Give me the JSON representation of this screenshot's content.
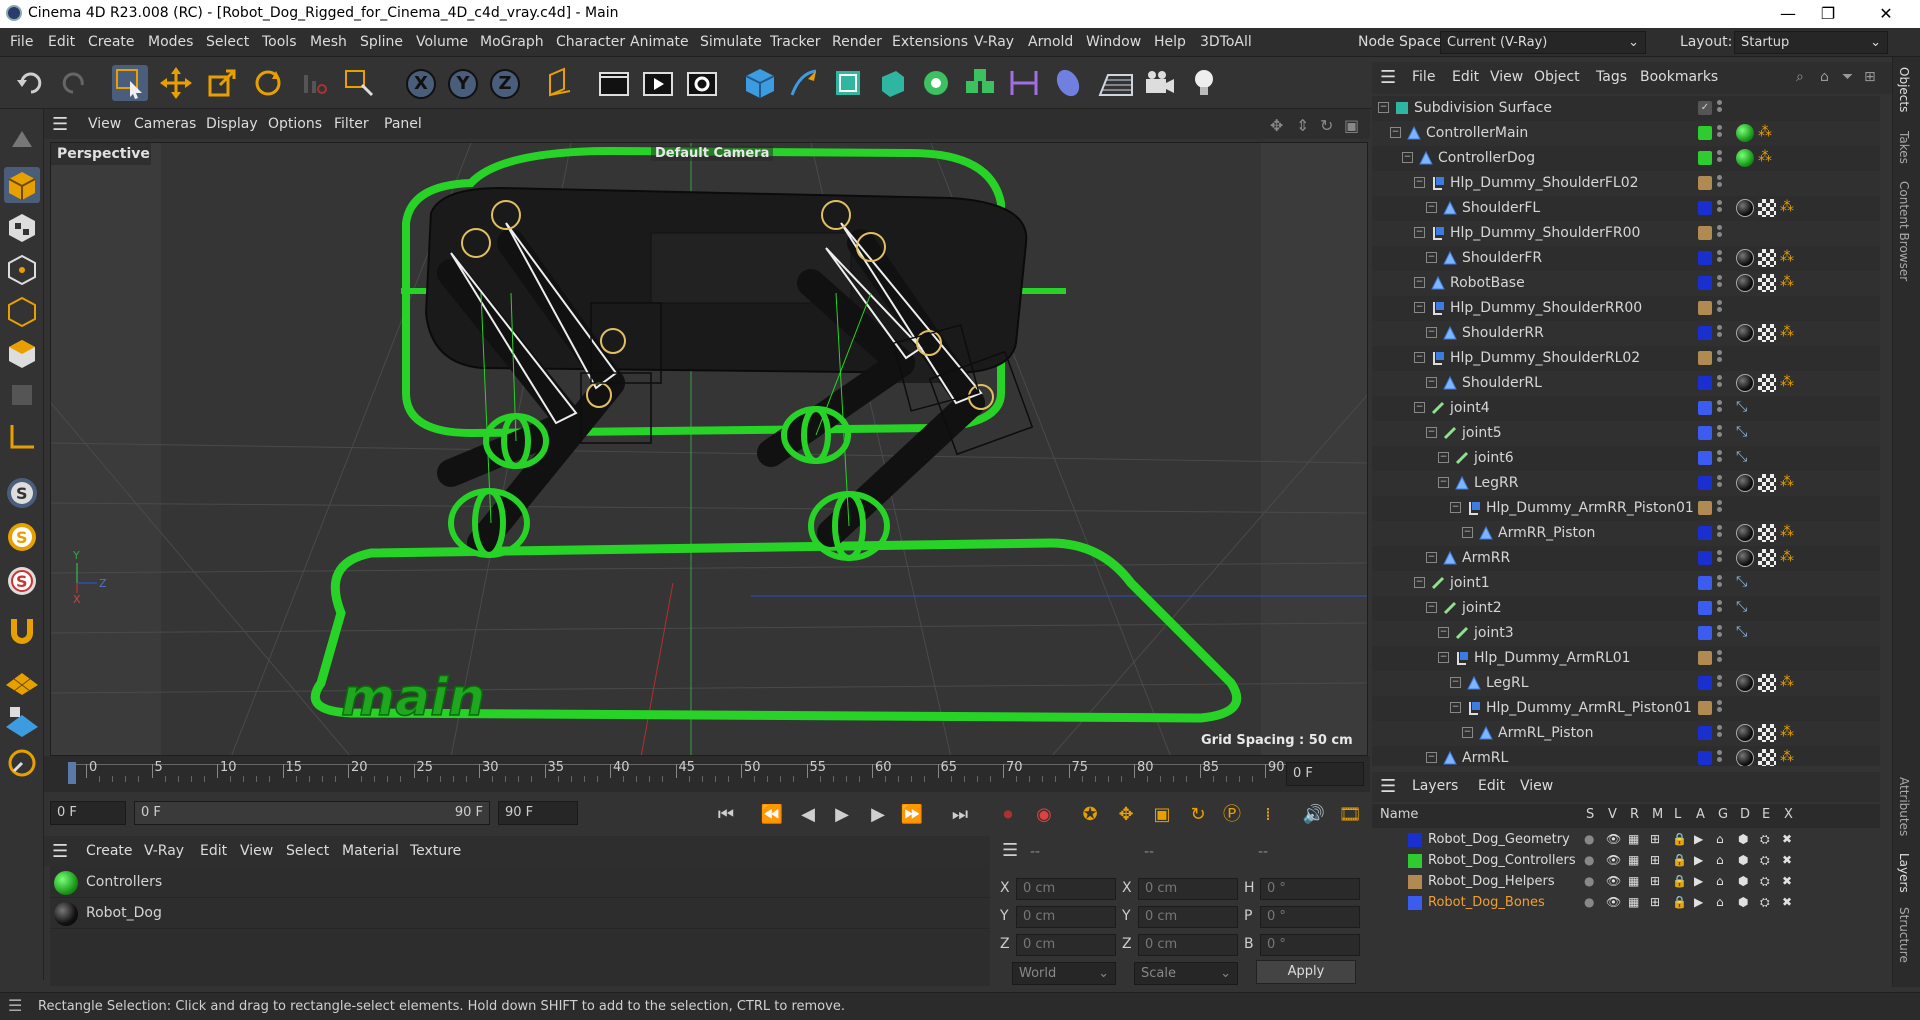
{
  "window": {
    "title": "Cinema 4D R23.008 (RC) - [Robot_Dog_Rigged_for_Cinema_4D_c4d_vray.c4d] - Main",
    "controls": [
      "—",
      "❐",
      "✕"
    ]
  },
  "menubar": {
    "items": [
      "File",
      "Edit",
      "Create",
      "Modes",
      "Select",
      "Tools",
      "Mesh",
      "Spline",
      "Volume",
      "MoGraph",
      "Character",
      "Animate",
      "Simulate",
      "Tracker",
      "Render",
      "Extensions",
      "V-Ray",
      "Arnold",
      "Window",
      "Help",
      "3DToAll"
    ],
    "node_space_label": "Node Space:",
    "node_space_value": "Current (V-Ray)",
    "layout_label": "Layout:",
    "layout_value": "Startup"
  },
  "toolbar": {
    "axis_x": "X",
    "axis_y": "Y",
    "axis_z": "Z"
  },
  "viewport": {
    "menu": [
      "Cameras",
      "Display",
      "Options",
      "Filter",
      "Panel"
    ],
    "view_menu": "View",
    "view_name": "Perspective",
    "camera_label": "Default Camera",
    "grid_spacing": "Grid Spacing : 50 cm",
    "controller_text": "main",
    "axis_x": "X",
    "axis_y": "Y",
    "axis_z": "Z"
  },
  "timeline": {
    "ticks": [
      "0",
      "5",
      "10",
      "15",
      "20",
      "25",
      "30",
      "35",
      "40",
      "45",
      "50",
      "55",
      "60",
      "65",
      "70",
      "75",
      "80",
      "85",
      "90"
    ],
    "current_frame": "0 F",
    "start_field": "0 F",
    "range_start": "0 F",
    "range_end": "90 F",
    "end_field": "90 F"
  },
  "material_manager": {
    "menu": [
      "Create",
      "V-Ray",
      "Edit",
      "View",
      "Select",
      "Material",
      "Texture"
    ],
    "materials": [
      {
        "name": "Controllers",
        "color": "#2ecc2e"
      },
      {
        "name": "Robot_Dog",
        "color": "#111111"
      }
    ]
  },
  "coordinates": {
    "header": [
      "--",
      "--",
      "--"
    ],
    "rows": [
      {
        "a_label": "X",
        "a_value": "0 cm",
        "b_label": "X",
        "b_value": "0 cm",
        "c_label": "H",
        "c_value": "0 °"
      },
      {
        "a_label": "Y",
        "a_value": "0 cm",
        "b_label": "Y",
        "b_value": "0 cm",
        "c_label": "P",
        "c_value": "0 °"
      },
      {
        "a_label": "Z",
        "a_value": "0 cm",
        "b_label": "Z",
        "b_value": "0 cm",
        "c_label": "B",
        "c_value": "0 °"
      }
    ],
    "space": "World",
    "mode": "Scale",
    "apply": "Apply"
  },
  "object_manager": {
    "menu": [
      "File",
      "Edit",
      "View",
      "Object",
      "Tags",
      "Bookmarks"
    ],
    "objects": [
      {
        "name": "Subdivision Surface",
        "depth": 0,
        "color": ""
      },
      {
        "name": "ControllerMain",
        "depth": 1,
        "color": "#2ecc2e"
      },
      {
        "name": "ControllerDog",
        "depth": 2,
        "color": "#2ecc2e"
      },
      {
        "name": "Hlp_Dummy_ShoulderFL02",
        "depth": 3,
        "color": "#b08a50"
      },
      {
        "name": "ShoulderFL",
        "depth": 4,
        "color": "#1a2fd0"
      },
      {
        "name": "Hlp_Dummy_ShoulderFR00",
        "depth": 3,
        "color": "#b08a50"
      },
      {
        "name": "ShoulderFR",
        "depth": 4,
        "color": "#1a2fd0"
      },
      {
        "name": "RobotBase",
        "depth": 3,
        "color": "#1a2fd0"
      },
      {
        "name": "Hlp_Dummy_ShoulderRR00",
        "depth": 3,
        "color": "#b08a50"
      },
      {
        "name": "ShoulderRR",
        "depth": 4,
        "color": "#1a2fd0"
      },
      {
        "name": "Hlp_Dummy_ShoulderRL02",
        "depth": 3,
        "color": "#b08a50"
      },
      {
        "name": "ShoulderRL",
        "depth": 4,
        "color": "#1a2fd0"
      },
      {
        "name": "joint4",
        "depth": 3,
        "color": "#3a5cf0"
      },
      {
        "name": "joint5",
        "depth": 4,
        "color": "#3a5cf0"
      },
      {
        "name": "joint6",
        "depth": 5,
        "color": "#3a5cf0"
      },
      {
        "name": "LegRR",
        "depth": 5,
        "color": "#1a2fd0"
      },
      {
        "name": "Hlp_Dummy_ArmRR_Piston01",
        "depth": 6,
        "color": "#b08a50"
      },
      {
        "name": "ArmRR_Piston",
        "depth": 7,
        "color": "#1a2fd0"
      },
      {
        "name": "ArmRR",
        "depth": 4,
        "color": "#1a2fd0"
      },
      {
        "name": "joint1",
        "depth": 3,
        "color": "#3a5cf0"
      },
      {
        "name": "joint2",
        "depth": 4,
        "color": "#3a5cf0"
      },
      {
        "name": "joint3",
        "depth": 5,
        "color": "#3a5cf0"
      },
      {
        "name": "Hlp_Dummy_ArmRL01",
        "depth": 5,
        "color": "#b08a50"
      },
      {
        "name": "LegRL",
        "depth": 6,
        "color": "#1a2fd0"
      },
      {
        "name": "Hlp_Dummy_ArmRL_Piston01",
        "depth": 6,
        "color": "#b08a50"
      },
      {
        "name": "ArmRL_Piston",
        "depth": 7,
        "color": "#1a2fd0"
      },
      {
        "name": "ArmRL",
        "depth": 4,
        "color": "#1a2fd0"
      }
    ]
  },
  "layers": {
    "menu": [
      "Layers",
      "Edit",
      "View"
    ],
    "columns": [
      "Name",
      "S",
      "V",
      "R",
      "M",
      "L",
      "A",
      "G",
      "D",
      "E",
      "X"
    ],
    "items": [
      {
        "name": "Robot_Dog_Geometry",
        "color": "#1a2fd0"
      },
      {
        "name": "Robot_Dog_Controllers",
        "color": "#2ecc2e"
      },
      {
        "name": "Robot_Dog_Helpers",
        "color": "#b08a50"
      },
      {
        "name": "Robot_Dog_Bones",
        "color": "#3a5cf0"
      }
    ]
  },
  "right_tabs": [
    "Objects",
    "Takes",
    "Content Browser",
    "Attributes",
    "Layers",
    "Structure"
  ],
  "status": {
    "text": "Rectangle Selection: Click and drag to rectangle-select elements. Hold down SHIFT to add to the selection, CTRL to remove."
  }
}
